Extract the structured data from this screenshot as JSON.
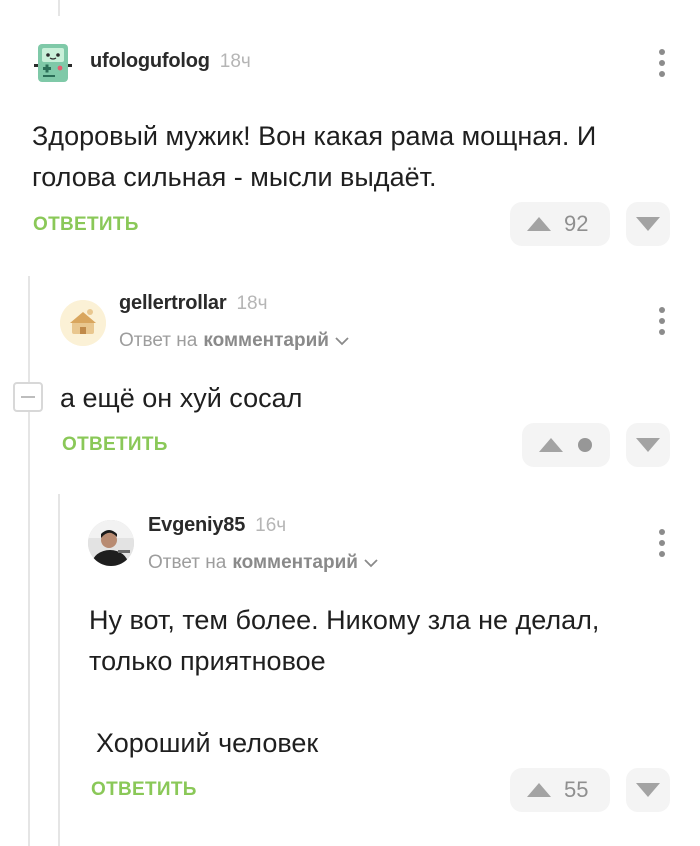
{
  "comments": [
    {
      "username": "ufologufolog",
      "time": "18ч",
      "text_lines": [
        "Здоровый мужик! Вон какая рама мощная. И",
        "голова сильная - мысли выдаёт."
      ],
      "reply_label": "ОТВЕТИТЬ",
      "rating": "92"
    },
    {
      "username": "gellertrollar",
      "time": "18ч",
      "reply_to_prefix": "Ответ на",
      "reply_to_link": "комментарий",
      "text_lines": [
        "а ещё он хуй сосал"
      ],
      "reply_label": "ОТВЕТИТЬ",
      "rating": ""
    },
    {
      "username": "Evgeniy85",
      "time": "16ч",
      "reply_to_prefix": "Ответ на",
      "reply_to_link": "комментарий",
      "text_lines": [
        "Ну вот, тем более. Никому зла не делал,",
        "только приятновое",
        "Хороший человек"
      ],
      "reply_label": "ОТВЕТИТЬ",
      "rating": "55"
    }
  ],
  "icons": {
    "upvote": "triangle-up-icon",
    "downvote": "triangle-down-icon",
    "more": "kebab-menu-icon",
    "collapse": "minus-icon",
    "chevron": "chevron-down-icon"
  },
  "colors": {
    "accent_green": "#8ac858",
    "pill_bg": "#f4f4f4",
    "muted_text": "#9d9d9d"
  }
}
